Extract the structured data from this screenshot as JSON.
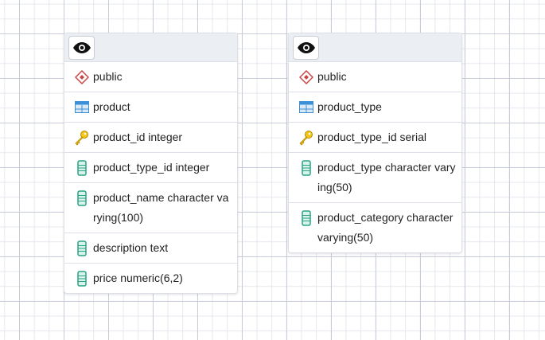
{
  "tables": [
    {
      "schema": "public",
      "name": "product",
      "columns": [
        {
          "icon": "key-icon",
          "text": "product_id integer"
        },
        {
          "icon": "column-icon",
          "text": "product_type_id integer"
        },
        {
          "icon": "column-icon",
          "text": "product_name character varying(100)"
        },
        {
          "icon": "column-icon",
          "text": "description text"
        },
        {
          "icon": "column-icon",
          "text": "price numeric(6,2)"
        }
      ]
    },
    {
      "schema": "public",
      "name": "product_type",
      "columns": [
        {
          "icon": "key-icon",
          "text": "product_type_id serial"
        },
        {
          "icon": "column-icon",
          "text": "product_type character varying(50)"
        },
        {
          "icon": "column-icon",
          "text": "product_category character varying(50)"
        }
      ]
    }
  ]
}
